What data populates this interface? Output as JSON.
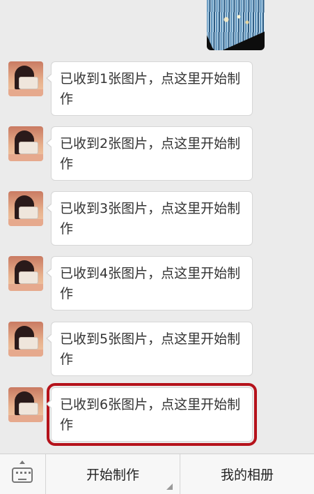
{
  "messages": [
    {
      "text": "已收到1张图片，点这里开始制作"
    },
    {
      "text": "已收到2张图片，点这里开始制作"
    },
    {
      "text": "已收到3张图片，点这里开始制作"
    },
    {
      "text": "已收到4张图片，点这里开始制作"
    },
    {
      "text": "已收到5张图片，点这里开始制作"
    },
    {
      "text": "已收到6张图片，点这里开始制作",
      "highlighted": true
    }
  ],
  "bottom_menu": {
    "start": "开始制作",
    "album": "我的相册"
  },
  "colors": {
    "highlight_border": "#b5121b",
    "background": "#ebebeb"
  }
}
